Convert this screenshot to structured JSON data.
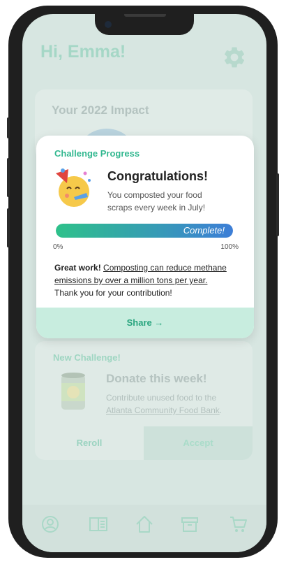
{
  "header": {
    "greeting": "Hi, Emma!"
  },
  "impact": {
    "title": "Your 2022 Impact"
  },
  "modal": {
    "header": "Challenge Progress",
    "title": "Congratulations!",
    "message": "You composted your food scraps every week in July!",
    "progress": {
      "value": 1.0,
      "label": "Complete!",
      "min_label": "0%",
      "max_label": "100%"
    },
    "great_lead": "Great work!",
    "fact": "Composting can reduce methane emissions by over a million tons per year.",
    "thanks": "Thank you for your contribution!",
    "share_label": "Share →"
  },
  "challenge": {
    "label": "New Challenge!",
    "title": "Donate this week!",
    "desc_prefix": "Contribute unused food to the",
    "desc_link": "Atlanta Community Food Bank",
    "desc_suffix": ".",
    "reroll_label": "Reroll",
    "accept_label": "Accept"
  },
  "tabs": [
    {
      "icon": "profile-icon"
    },
    {
      "icon": "journal-icon"
    },
    {
      "icon": "home-icon"
    },
    {
      "icon": "archive-icon"
    },
    {
      "icon": "cart-icon"
    }
  ],
  "colors": {
    "accent": "#33b890",
    "background": "#d7e6e1",
    "progress_start": "#2ec18a",
    "progress_end": "#3d7ed7"
  }
}
